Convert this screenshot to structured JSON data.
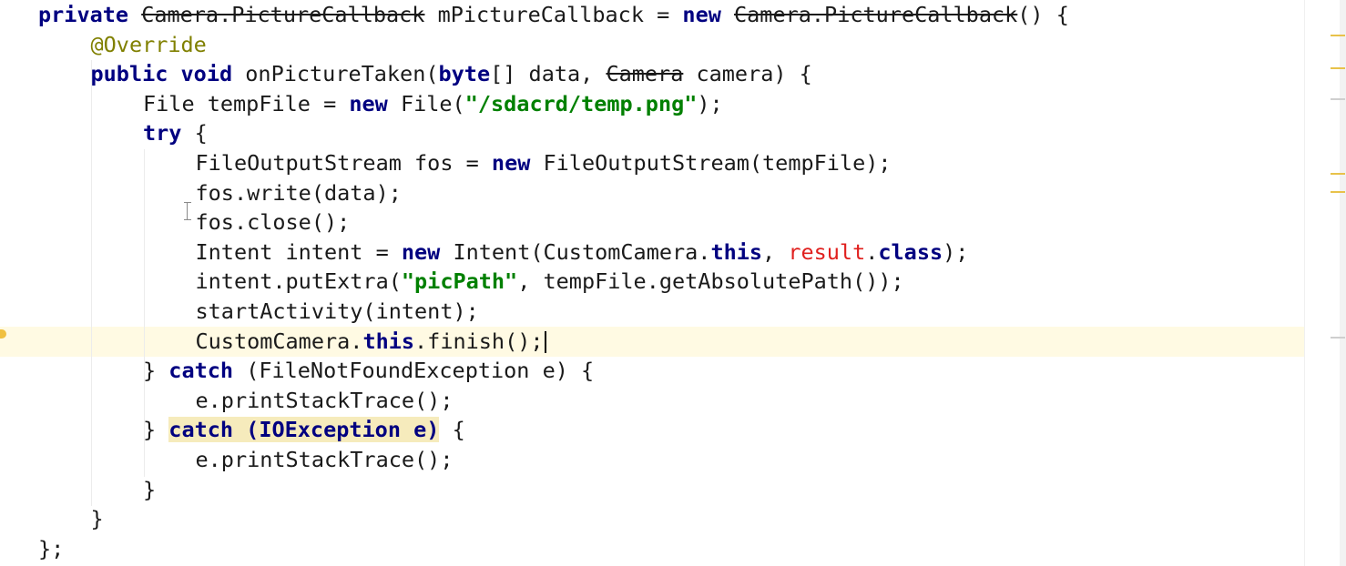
{
  "editor": {
    "lines": [
      {
        "indent": 0,
        "tokens": [
          {
            "t": "private ",
            "c": "kw"
          },
          {
            "t": "Camera.PictureCallback",
            "c": "strike"
          },
          {
            "t": " mPictureCallback = "
          },
          {
            "t": "new ",
            "c": "kw"
          },
          {
            "t": "Camera.PictureCallback",
            "c": "strike"
          },
          {
            "t": "() {"
          }
        ]
      },
      {
        "indent": 1,
        "tokens": [
          {
            "t": "@Override",
            "c": "ann"
          }
        ]
      },
      {
        "indent": 1,
        "tokens": [
          {
            "t": "public void ",
            "c": "kw"
          },
          {
            "t": "onPictureTaken("
          },
          {
            "t": "byte",
            "c": "kw"
          },
          {
            "t": "[] data, "
          },
          {
            "t": "Camera",
            "c": "strike"
          },
          {
            "t": " camera) {"
          }
        ]
      },
      {
        "indent": 2,
        "tokens": [
          {
            "t": "File tempFile = "
          },
          {
            "t": "new ",
            "c": "kw"
          },
          {
            "t": "File("
          },
          {
            "t": "\"/sdacrd/temp.png\"",
            "c": "str"
          },
          {
            "t": ");"
          }
        ]
      },
      {
        "indent": 2,
        "tokens": [
          {
            "t": "try ",
            "c": "kw"
          },
          {
            "t": "{"
          }
        ]
      },
      {
        "indent": 3,
        "tokens": [
          {
            "t": "FileOutputStream fos = "
          },
          {
            "t": "new ",
            "c": "kw"
          },
          {
            "t": "FileOutputStream(tempFile);"
          }
        ]
      },
      {
        "indent": 3,
        "tokens": [
          {
            "t": "fos.write(data);"
          }
        ]
      },
      {
        "indent": 3,
        "tokens": [
          {
            "t": "fos.close();"
          }
        ]
      },
      {
        "indent": 3,
        "tokens": [
          {
            "t": "Intent intent = "
          },
          {
            "t": "new ",
            "c": "kw"
          },
          {
            "t": "Intent(CustomCamera."
          },
          {
            "t": "this",
            "c": "kw"
          },
          {
            "t": ", "
          },
          {
            "t": "result",
            "c": "err"
          },
          {
            "t": "."
          },
          {
            "t": "class",
            "c": "kw"
          },
          {
            "t": ");"
          }
        ]
      },
      {
        "indent": 3,
        "tokens": [
          {
            "t": "intent.putExtra("
          },
          {
            "t": "\"picPath\"",
            "c": "str"
          },
          {
            "t": ", tempFile.getAbsolutePath());"
          }
        ]
      },
      {
        "indent": 3,
        "tokens": [
          {
            "t": "startActivity(intent);"
          }
        ]
      },
      {
        "indent": 3,
        "current": true,
        "caret": true,
        "tokens": [
          {
            "t": "CustomCamera."
          },
          {
            "t": "this",
            "c": "kw"
          },
          {
            "t": ".finish();"
          }
        ]
      },
      {
        "indent": 2,
        "tokens": [
          {
            "t": "} "
          },
          {
            "t": "catch ",
            "c": "kw"
          },
          {
            "t": "(FileNotFoundException e) {"
          }
        ]
      },
      {
        "indent": 3,
        "tokens": [
          {
            "t": "e.printStackTrace();"
          }
        ]
      },
      {
        "indent": 2,
        "tokens": [
          {
            "t": "} "
          },
          {
            "t": "catch (IOException e)",
            "c": "kw hl"
          },
          {
            "t": " {"
          }
        ]
      },
      {
        "indent": 3,
        "tokens": [
          {
            "t": "e.printStackTrace();"
          }
        ]
      },
      {
        "indent": 2,
        "tokens": [
          {
            "t": "}"
          }
        ]
      },
      {
        "indent": 1,
        "tokens": [
          {
            "t": "}"
          }
        ]
      },
      {
        "indent": 0,
        "tokens": [
          {
            "t": "};"
          }
        ]
      }
    ]
  },
  "colors": {
    "keyword": "#000080",
    "string": "#008000",
    "annotation": "#808000",
    "error": "#e0201e",
    "current_line": "#fffae3",
    "match_highlight": "#f6ebbc"
  },
  "gutter_icons": [
    "lightbulb-icon"
  ],
  "scrollbar_markers": [
    {
      "kind": "warning",
      "color": "#e8c24a"
    },
    {
      "kind": "warning",
      "color": "#e8c24a"
    },
    {
      "kind": "info",
      "color": "#cfcfcf"
    },
    {
      "kind": "warning",
      "color": "#e8c24a"
    },
    {
      "kind": "warning",
      "color": "#e8c24a"
    },
    {
      "kind": "info",
      "color": "#cfcfcf"
    }
  ]
}
